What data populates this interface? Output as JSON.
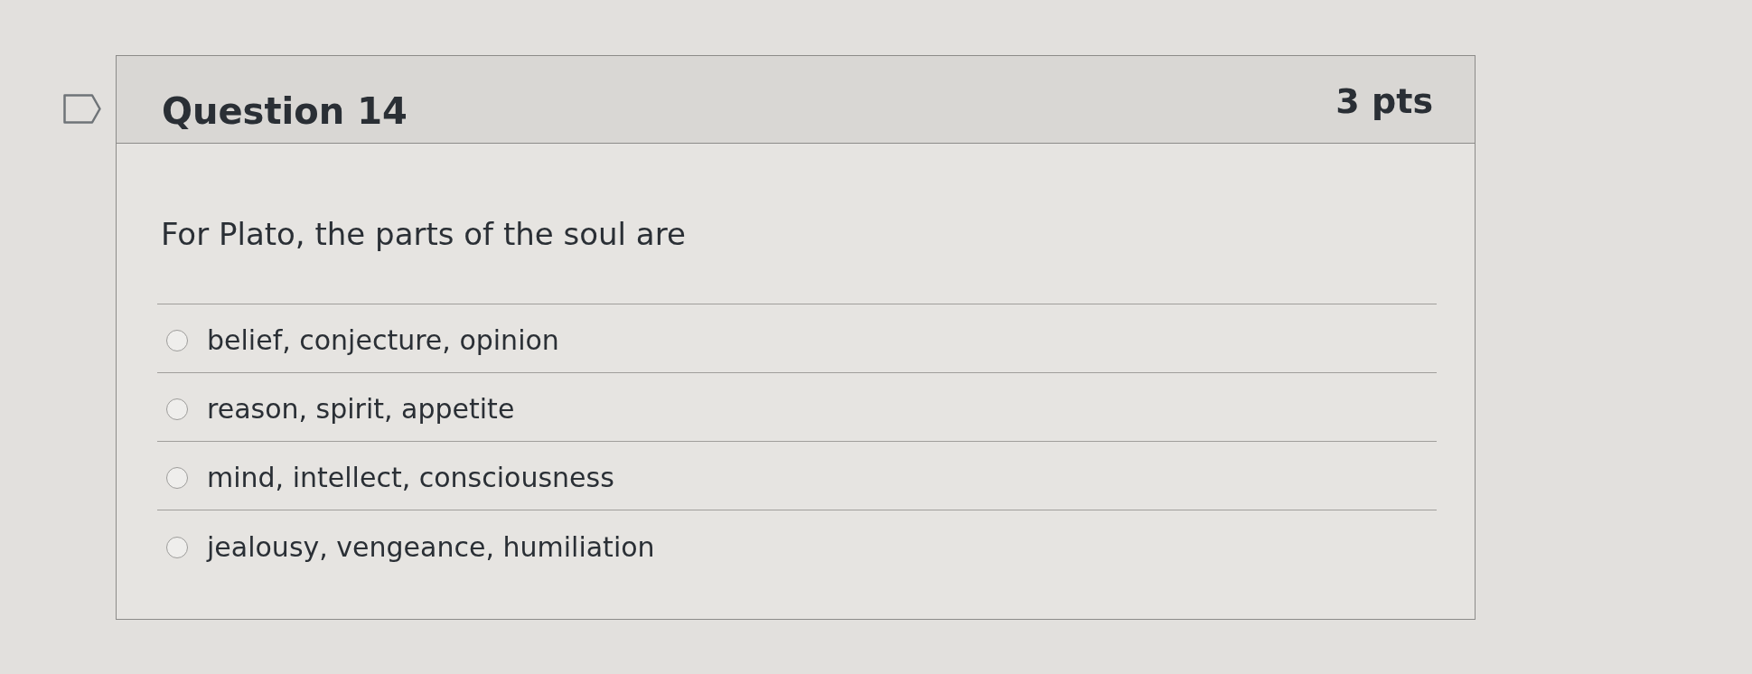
{
  "question": {
    "flagged": false,
    "title": "Question 14",
    "points": "3 pts",
    "text": "For Plato, the parts of the soul are",
    "answers": [
      {
        "label": "belief, conjecture, opinion",
        "selected": false
      },
      {
        "label": "reason, spirit, appetite",
        "selected": false
      },
      {
        "label": "mind, intellect, consciousness",
        "selected": false
      },
      {
        "label": "jealousy, vengeance, humiliation",
        "selected": false
      }
    ]
  }
}
